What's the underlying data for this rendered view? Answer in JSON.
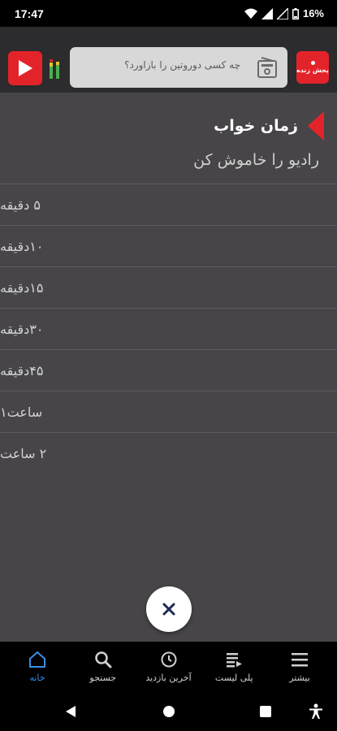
{
  "status_bar": {
    "time": "17:47",
    "battery": "16%"
  },
  "top_bar": {
    "search_placeholder": "چه کسی دوروتین را بازاورد؟",
    "live_label": "پخش زنده"
  },
  "sleep_timer": {
    "title": "زمان خواب",
    "subtitle": "رادیو را خاموش کن",
    "options": [
      "۵ دقیقه",
      "۱۰دقیقه",
      "۱۵دقیقه",
      "۳۰دقیقه",
      "۴۵دقیقه",
      "ساعت۱",
      "۲ ساعت"
    ]
  },
  "bottom_nav": {
    "items": [
      {
        "label": "خانه",
        "icon": "home-icon"
      },
      {
        "label": "جستجو",
        "icon": "search-icon"
      },
      {
        "label": "آخرین بازدید",
        "icon": "history-icon"
      },
      {
        "label": "پلی لیست",
        "icon": "playlist-icon"
      },
      {
        "label": "بیشتر",
        "icon": "menu-icon"
      }
    ],
    "active_index": 0
  },
  "colors": {
    "accent": "#e2242a",
    "panel": "#474548",
    "nav_active": "#3a8ee6"
  }
}
